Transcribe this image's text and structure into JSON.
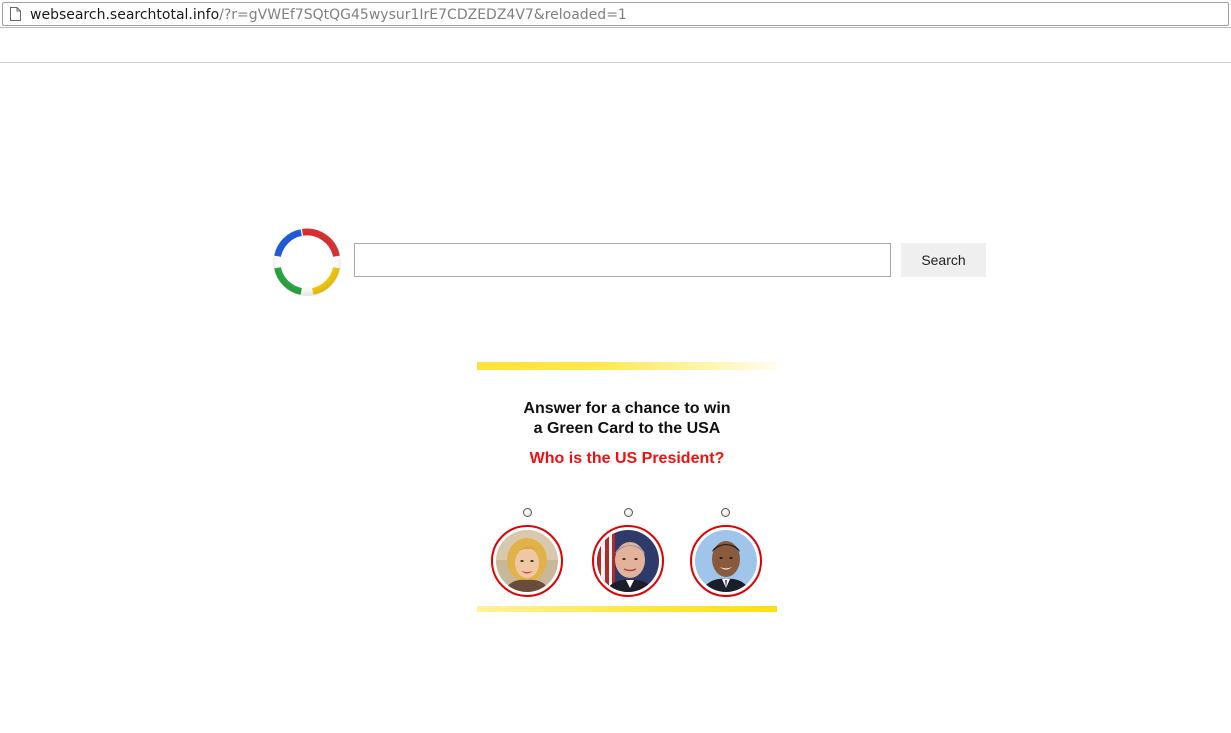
{
  "address_bar": {
    "url_host": "websearch.searchtotal.info",
    "url_path": "/?r=gVWEf7SQtQG45wysur1IrE7CDZEDZ4V7&reloaded=1"
  },
  "search": {
    "input_value": "",
    "button_label": "Search"
  },
  "promo": {
    "headline_line1": "Answer for a chance to win",
    "headline_line2": "a Green Card to the USA",
    "question": "Who is the US President?",
    "options": [
      {
        "icon": "portrait-woman-blonde-icon"
      },
      {
        "icon": "portrait-man-grey-hair-icon"
      },
      {
        "icon": "portrait-man-dark-hair-icon"
      }
    ],
    "colors": {
      "question_text": "#ee1111",
      "portrait_ring": "#e00000",
      "bar_yellow": "#ffde10"
    }
  },
  "logo": {
    "colors": [
      "#d52b2b",
      "#1a56d6",
      "#22a33a",
      "#f3c400"
    ]
  }
}
